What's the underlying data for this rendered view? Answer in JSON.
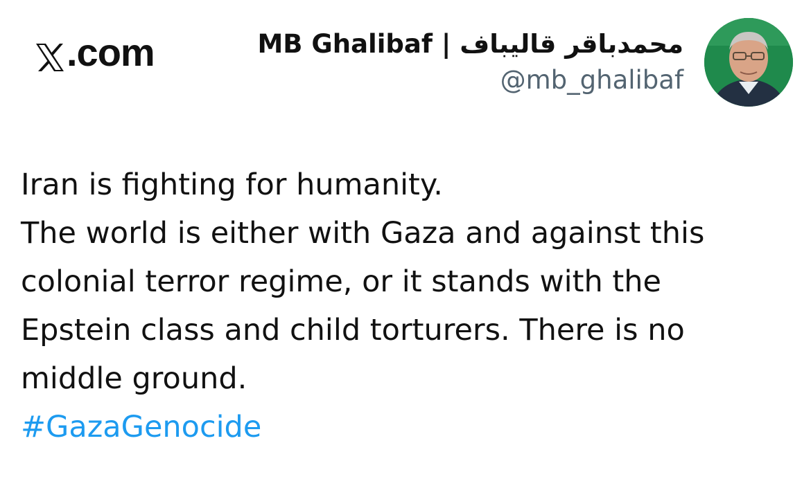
{
  "site": {
    "label": "X.com"
  },
  "author": {
    "display_name": "MB Ghalibaf | محمدباقر قالیباف",
    "handle": "@mb_ghalibaf",
    "avatar_icon": "profile-photo-avatar"
  },
  "tweet": {
    "lines": [
      "Iran is fighting for humanity.",
      "The world is either with Gaza and against this",
      "colonial terror regime, or it stands with the",
      "Epstein class and child torturers. There is no",
      "middle ground."
    ],
    "hashtag": "#GazaGenocide"
  },
  "colors": {
    "hashtag": "#1d9bf0",
    "handle": "#536471",
    "text": "#111111",
    "avatar_bg": "#1f8a4c"
  }
}
